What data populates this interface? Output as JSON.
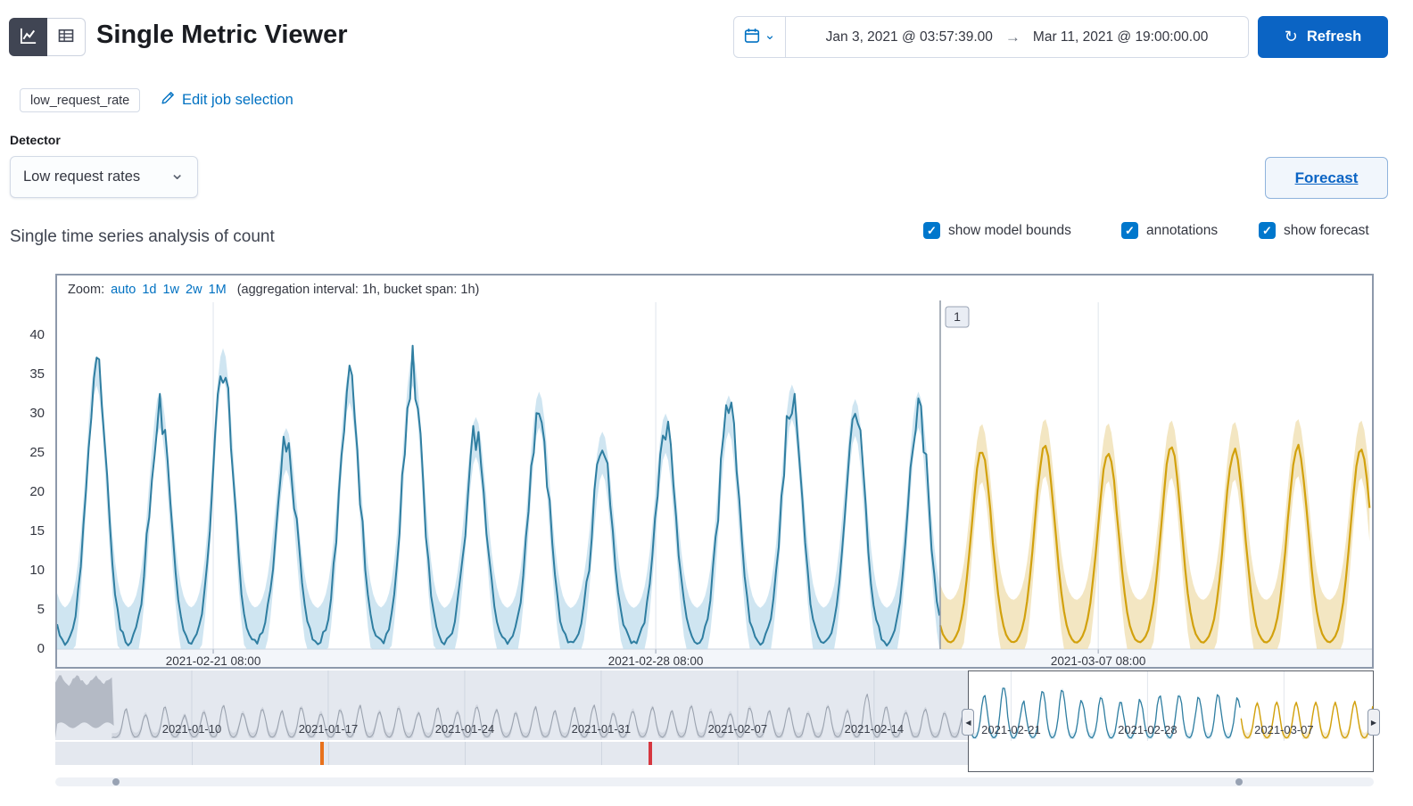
{
  "header": {
    "title": "Single Metric Viewer",
    "datepicker": {
      "start": "Jan 3, 2021 @ 03:57:39.00",
      "arrow": "→",
      "end": "Mar 11, 2021 @ 19:00:00.00"
    },
    "refresh_label": "Refresh"
  },
  "icons": {
    "check": "✓",
    "refresh": "↻",
    "chevron_down": "⌄",
    "left_handle": "◀",
    "right_handle": "▶"
  },
  "job": {
    "badge": "low_request_rate",
    "edit_link": "Edit job selection"
  },
  "detector": {
    "label": "Detector",
    "selected": "Low request rates"
  },
  "forecast_button_label": "Forecast",
  "analysis": {
    "heading": "Single time series analysis of count",
    "checkboxes": [
      {
        "label": "show model bounds",
        "checked": true
      },
      {
        "label": "annotations",
        "checked": true
      },
      {
        "label": "show forecast",
        "checked": true
      }
    ]
  },
  "zoom": {
    "prefix": "Zoom:",
    "links": [
      "auto",
      "1d",
      "1w",
      "2w",
      "1M"
    ],
    "suffix": "(aggregation interval: 1h, bucket span: 1h)"
  },
  "chart_data": {
    "type": "line",
    "title": "Single time series analysis of count",
    "ylim": [
      0,
      42
    ],
    "yticks": [
      40,
      35,
      30,
      25,
      20,
      15,
      10,
      5,
      0
    ],
    "xticks": [
      {
        "label": "2021-02-21 08:00",
        "day": 2.47
      },
      {
        "label": "2021-02-28 08:00",
        "day": 9.47
      },
      {
        "label": "2021-03-07 08:00",
        "day": 16.47
      }
    ],
    "span_days": 20.8,
    "forecast_start_day": 13.97,
    "day_phase": 0.125,
    "annotation": {
      "id": "1",
      "day": 13.97
    },
    "series": [
      {
        "name": "actual count",
        "color": "#2f7ea1",
        "band_color": "#c3dfed",
        "day_offset": 0,
        "band_width": 4.5,
        "daily_peaks": [
          35,
          30,
          36,
          25,
          33,
          35,
          26.5,
          30,
          24.5,
          27,
          29.5,
          31,
          29,
          30,
          28
        ]
      },
      {
        "name": "forecast",
        "color": "#d2a10d",
        "band_color": "#eedca8",
        "day_offset": 13,
        "band_width": 5.5,
        "daily_peaks": [
          25,
          24.5,
          25.2,
          24.6,
          25,
          24.8,
          25.2,
          25
        ]
      }
    ]
  },
  "context": {
    "span_days": 67.63,
    "selection_start_day": 46.83,
    "forecast_start_day": 60.8,
    "labels": [
      {
        "label": "2021-01-10",
        "day": 7
      },
      {
        "label": "2021-01-17",
        "day": 14
      },
      {
        "label": "2021-01-24",
        "day": 21
      },
      {
        "label": "2021-01-31",
        "day": 28
      },
      {
        "label": "2021-02-07",
        "day": 35
      },
      {
        "label": "2021-02-14",
        "day": 42
      }
    ],
    "selection_labels": [
      {
        "label": "2021-02-21",
        "day": 49
      },
      {
        "label": "2021-02-28",
        "day": 56
      },
      {
        "label": "2021-03-07",
        "day": 63
      }
    ],
    "gray_peaks": [
      0,
      0,
      0,
      19,
      16,
      21,
      15,
      18,
      22,
      17,
      20,
      18,
      21,
      17,
      19,
      22,
      18,
      21,
      17,
      20,
      18,
      22,
      19,
      17,
      21,
      18,
      20,
      22,
      17,
      19,
      21,
      18,
      22,
      19,
      17,
      21,
      18,
      20,
      17,
      22,
      19,
      30,
      21,
      18,
      20,
      17,
      19
    ],
    "annotation_marks": [
      {
        "pos": 0.202,
        "color": "#e8711c"
      },
      {
        "pos": 0.451,
        "color": "#d6373f"
      }
    ]
  },
  "scrollbar": {
    "dot_positions": [
      0.046,
      0.898
    ]
  }
}
